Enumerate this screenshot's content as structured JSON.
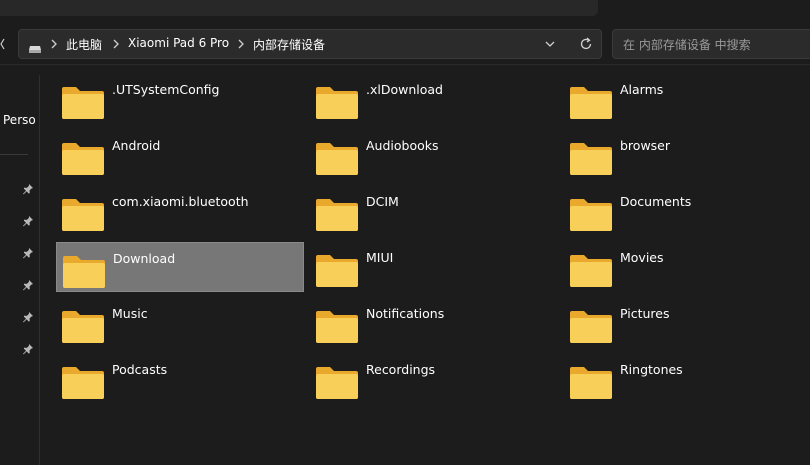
{
  "address_bar": {
    "breadcrumbs": [
      "此电脑",
      "Xiaomi Pad 6 Pro",
      "内部存储设备"
    ]
  },
  "search": {
    "placeholder": "在 内部存储设备 中搜索"
  },
  "sidebar": {
    "partial_label": "Perso",
    "pinned_count": 6
  },
  "folders": [
    ".UTSystemConfig",
    ".xlDownload",
    "Alarms",
    "Android",
    "Audiobooks",
    "browser",
    "com.xiaomi.bluetooth",
    "DCIM",
    "Documents",
    "Download",
    "MIUI",
    "Movies",
    "Music",
    "Notifications",
    "Pictures",
    "Podcasts",
    "Recordings",
    "Ringtones"
  ],
  "selected_folder": "Download",
  "colors": {
    "background": "#1c1c1c",
    "folder_front": "#f8cf58",
    "folder_back": "#e8a92d",
    "selection": "#777777"
  }
}
